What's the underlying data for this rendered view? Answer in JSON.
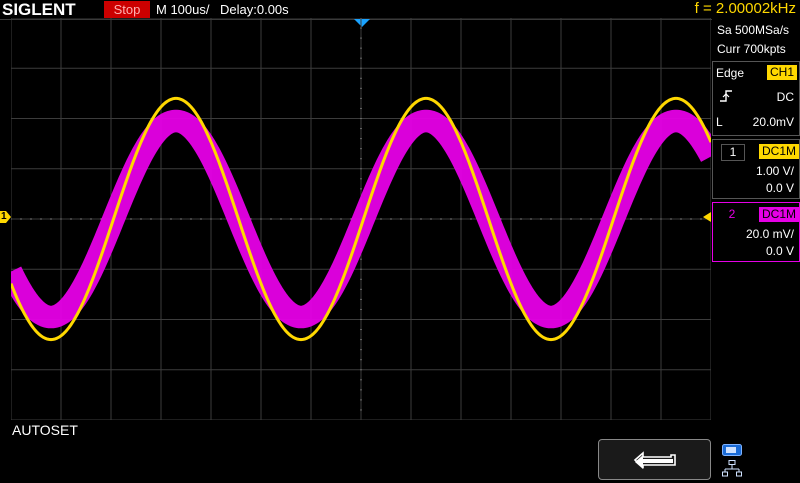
{
  "header": {
    "brand": "SIGLENT",
    "run_state": "Stop",
    "timebase": "M 100us/",
    "delay": "Delay:0.00s",
    "frequency": "f = 2.00002kHz"
  },
  "acquisition": {
    "sample_rate": "Sa 500MSa/s",
    "memory_depth": "Curr 700kpts"
  },
  "trigger": {
    "type": "Edge",
    "source": "CH1",
    "coupling": "DC",
    "level_prefix": "L",
    "level": "20.0mV",
    "slope_icon": "rising-edge-icon"
  },
  "channels": [
    {
      "number": "1",
      "coupling": "DC1M",
      "scale": "1.00 V/",
      "offset": "0.0 V",
      "color": "#ffd800"
    },
    {
      "number": "2",
      "coupling": "DC1M",
      "scale": "20.0 mV/",
      "offset": "0.0 V",
      "color": "#e600e6"
    }
  ],
  "channel_marker": {
    "label": "1"
  },
  "waveforms": {
    "period_divisions": 5,
    "ch1_amplitude_divisions": 2.4,
    "ch2_amplitude_divisions": 1.95,
    "ch2_thickness_divisions": 0.45
  },
  "footer": {
    "menu_title": "AUTOSET"
  },
  "icons": {
    "back": "back-arrow-icon",
    "usb": "usb-icon",
    "network": "network-icon"
  }
}
